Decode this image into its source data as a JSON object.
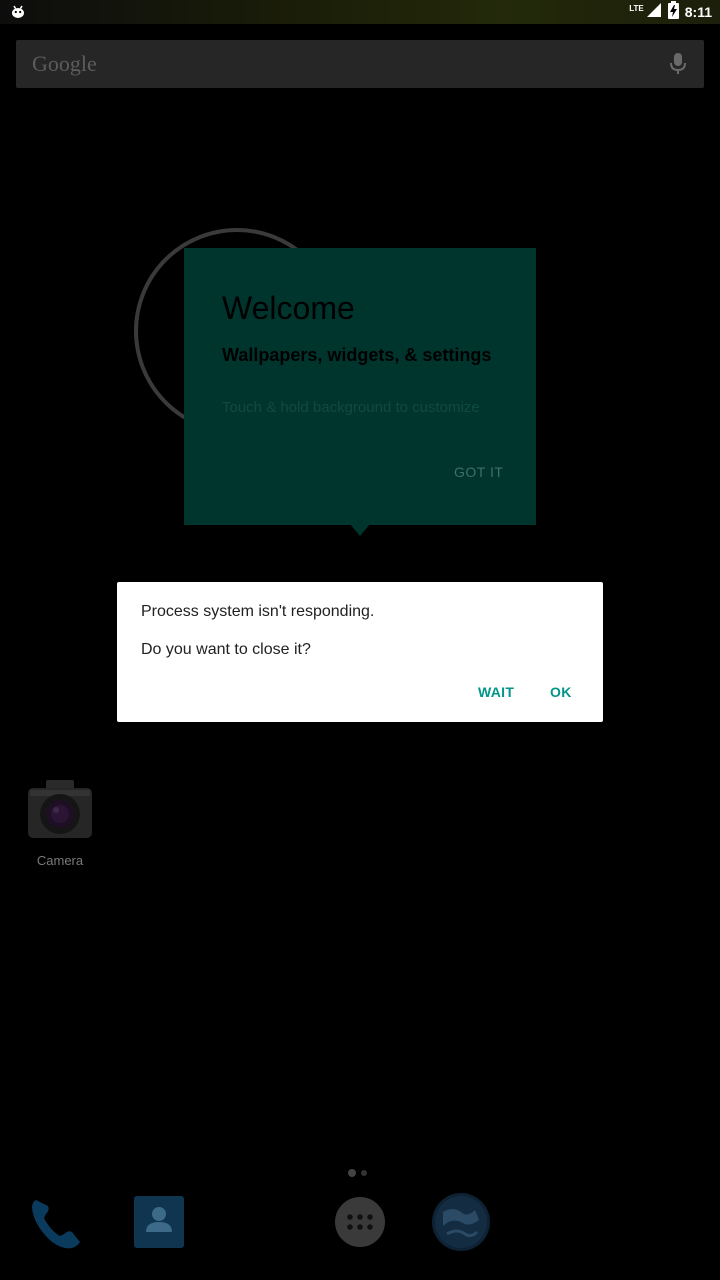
{
  "status_bar": {
    "time": "8:11",
    "network": "LTE",
    "icons": [
      "android-notification-icon",
      "signal-icon",
      "battery-charging-icon"
    ]
  },
  "search_bar": {
    "logo_text": "Google",
    "mic_icon": "microphone-icon"
  },
  "welcome_cling": {
    "title": "Welcome",
    "subtitle": "Wallpapers, widgets, & settings",
    "body": "Touch & hold background to customize",
    "button_label": "GOT IT",
    "background_color": "#00352e"
  },
  "home_apps": [
    {
      "label": "Camera",
      "icon": "camera-icon"
    }
  ],
  "page_indicator": {
    "pages": 2,
    "current": 1
  },
  "dock": [
    {
      "icon": "phone-icon"
    },
    {
      "icon": "contacts-icon"
    },
    {
      "icon": "app-drawer-icon"
    },
    {
      "icon": "browser-globe-icon"
    }
  ],
  "dialog": {
    "message_line1": "Process system isn't responding.",
    "message_line2": "Do you want to close it?",
    "wait_label": "WAIT",
    "ok_label": "OK",
    "accent_color": "#009688"
  }
}
